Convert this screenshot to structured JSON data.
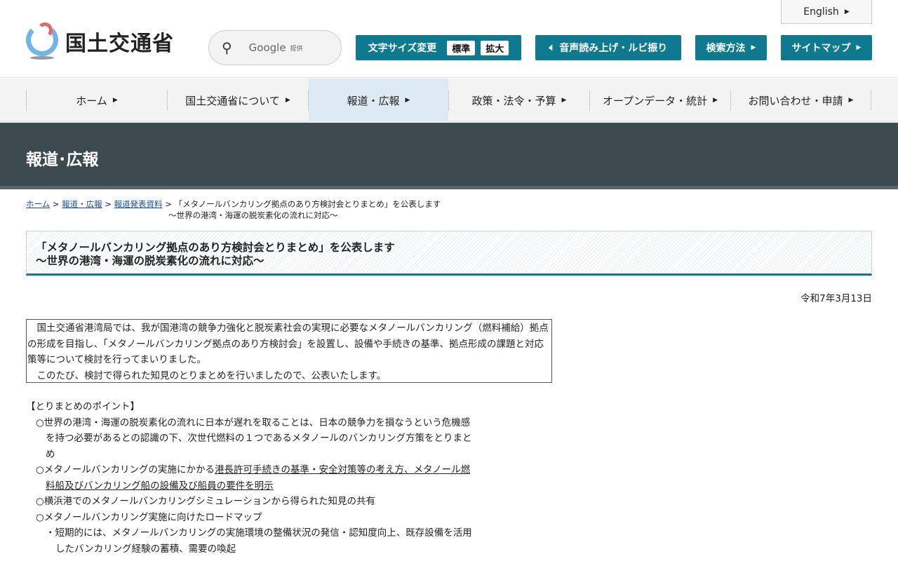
{
  "header": {
    "logo_text": "国土交通省",
    "search_google": "Google",
    "search_provided": "提供",
    "font_size_label": "文字サイズ変更",
    "font_standard": "標準",
    "font_large": "拡大",
    "read_aloud": "音声読み上げ・ルビ振り",
    "search_method": "検索方法",
    "sitemap": "サイトマップ",
    "english": "English"
  },
  "nav": [
    "ホーム",
    "国土交通省について",
    "報道・広報",
    "政策・法令・予算",
    "オープンデータ・統計",
    "お問い合わせ・申請"
  ],
  "section_title": "報道･広報",
  "breadcrumb": {
    "home": "ホーム",
    "press": "報道・広報",
    "release": "報道発表資料",
    "current1": "「メタノールバンカリング拠点のあり方検討会とりまとめ」を公表します",
    "current2": "～世界の港湾・海運の脱炭素化の流れに対応～"
  },
  "article": {
    "title1": "「メタノールバンカリング拠点のあり方検討会とりまとめ」を公表します",
    "title2": "～世界の港湾・海運の脱炭素化の流れに対応～",
    "date": "令和7年3月13日",
    "lead1": "　国土交通省港湾局では、我が国港湾の競争力強化と脱炭素社会の実現に必要なメタノールバンカリング（燃料補給）拠点の形成を目指し、「メタノールバンカリング拠点のあり方検討会」を設置し、設備や手続きの基準、拠点形成の課題と対応策等について検討を行ってまいりました。",
    "lead2": "　このたび、検討で得られた知見のとりまとめを行いましたので、公表いたします。",
    "points_heading": "【とりまとめのポイント】",
    "p1": "○世界の港湾・海運の脱炭素化の流れに日本が遅れを取ることは、日本の競争力を損なうという危機感を持つ必要があるとの認識の下、次世代燃料の１つであるメタノールのバンカリング方策をとりまとめ",
    "p2a": "○メタノールバンカリングの実施にかかる",
    "p2b": "港長許可手続きの基準・安全対策等の考え方、メタノール燃料船及びバンカリング船の設備及び船員の要件を明示",
    "p3": "○横浜港でのメタノールバンカリングシミュレーションから得られた知見の共有",
    "p4": "○メタノールバンカリング実施に向けたロードマップ",
    "p4a": "・短期的には、メタノールバンカリングの実施環境の整備状況の発信・認知度向上、既存設備を活用したバンカリング経験の蓄積、需要の喚起"
  }
}
